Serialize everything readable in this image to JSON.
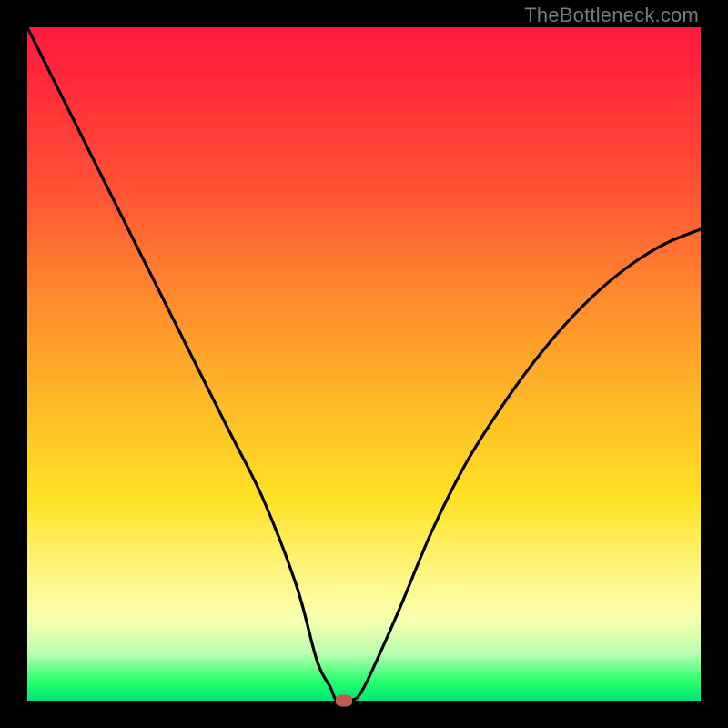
{
  "watermark": "TheBottleneck.com",
  "chart_data": {
    "type": "line",
    "title": "",
    "xlabel": "",
    "ylabel": "",
    "xlim": [
      0,
      100
    ],
    "ylim": [
      0,
      100
    ],
    "grid": false,
    "series": [
      {
        "name": "curve",
        "x": [
          0,
          5,
          10,
          15,
          20,
          25,
          30,
          35,
          40,
          43,
          45,
          46,
          48,
          50,
          55,
          60,
          65,
          70,
          75,
          80,
          85,
          90,
          95,
          100
        ],
        "y": [
          100,
          90,
          80,
          70,
          60,
          50,
          40,
          30,
          17,
          6,
          2,
          0,
          0,
          2,
          13,
          25,
          35,
          43,
          50,
          56,
          61,
          65,
          68,
          70
        ]
      }
    ],
    "marker": {
      "x": 47,
      "y": 0
    },
    "background_gradient": {
      "stops": [
        {
          "pos": 0,
          "color": "#ff1a3c"
        },
        {
          "pos": 70,
          "color": "#ffe223"
        },
        {
          "pos": 100,
          "color": "#00e676"
        }
      ]
    }
  }
}
